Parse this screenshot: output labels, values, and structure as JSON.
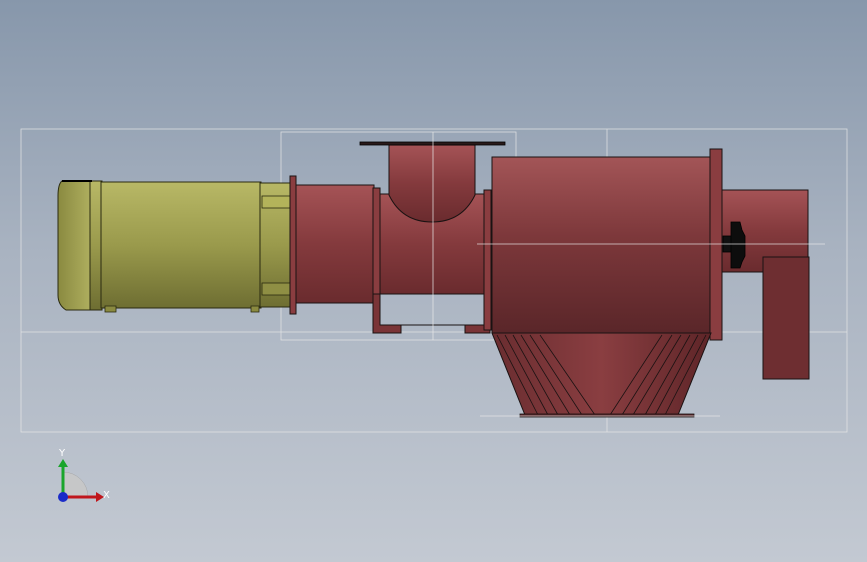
{
  "viewport": {
    "background_top": "#8797ab",
    "background_bottom": "#c3c9d2"
  },
  "model": {
    "motor_color": "#9b9b4c",
    "body_color": "#7a3437",
    "outline_color": "#1a1212",
    "guide_line_color": "#e6e6e6"
  },
  "triad": {
    "x_label": "X",
    "y_label": "Y",
    "x_color": "#c0161c",
    "y_color": "#1aa52b",
    "z_color": "#1a2bc8"
  }
}
